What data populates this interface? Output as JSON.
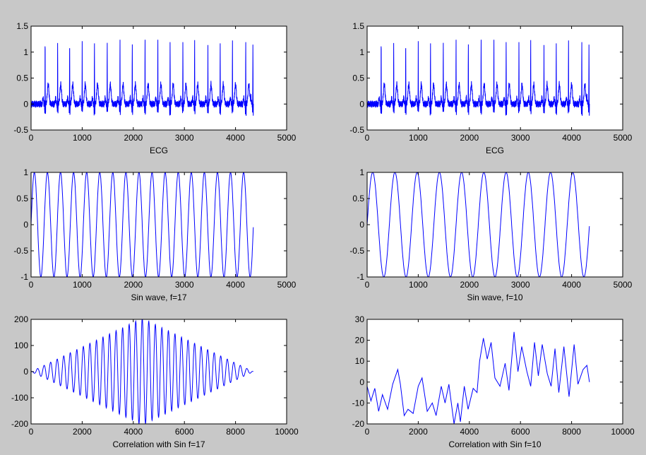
{
  "figure": {
    "background": "#c8c8c8",
    "axes_background": "#ffffff",
    "line_color": "#0000ff"
  },
  "chart_data": [
    {
      "type": "line",
      "xlabel": "ECG",
      "xlim": [
        0,
        5000
      ],
      "ylim": [
        -0.5,
        1.5
      ],
      "xticks": [
        "0",
        "1000",
        "2000",
        "3000",
        "4000",
        "5000"
      ],
      "yticks": [
        "-0.5",
        "0",
        "0.5",
        "1",
        "1.5"
      ],
      "signal": {
        "kind": "ecg",
        "n": 4350,
        "beats": [
          275,
          520,
          755,
          1000,
          1240,
          1490,
          1740,
          1980,
          2230,
          2480,
          2720,
          2970,
          3200,
          3460,
          3700,
          3940,
          4200,
          4340
        ],
        "r_peak": 1.2,
        "baseline": 0.0,
        "min": -0.45
      }
    },
    {
      "type": "line",
      "xlabel": "ECG",
      "xlim": [
        0,
        5000
      ],
      "ylim": [
        -0.5,
        1.5
      ],
      "xticks": [
        "0",
        "1000",
        "2000",
        "3000",
        "4000",
        "5000"
      ],
      "yticks": [
        "-0.5",
        "0",
        "0.5",
        "1",
        "1.5"
      ],
      "signal": {
        "kind": "ecg",
        "n": 4350,
        "beats": [
          275,
          520,
          755,
          1000,
          1240,
          1490,
          1740,
          1980,
          2230,
          2480,
          2720,
          2970,
          3200,
          3460,
          3700,
          3940,
          4200,
          4340
        ],
        "r_peak": 1.2,
        "baseline": 0.0,
        "min": -0.45
      }
    },
    {
      "type": "line",
      "xlabel": "Sin wave, f=17",
      "xlim": [
        0,
        5000
      ],
      "ylim": [
        -1,
        1
      ],
      "xticks": [
        "0",
        "1000",
        "2000",
        "3000",
        "4000",
        "5000"
      ],
      "yticks": [
        "-1",
        "-0.5",
        "0",
        "0.5",
        "1"
      ],
      "signal": {
        "kind": "sin",
        "n": 4350,
        "cycles": 17,
        "amplitude": 1
      }
    },
    {
      "type": "line",
      "xlabel": "Sin wave, f=10",
      "xlim": [
        0,
        5000
      ],
      "ylim": [
        -1,
        1
      ],
      "xticks": [
        "0",
        "1000",
        "2000",
        "3000",
        "4000",
        "5000"
      ],
      "yticks": [
        "-1",
        "-0.5",
        "0",
        "0.5",
        "1"
      ],
      "signal": {
        "kind": "sin",
        "n": 4350,
        "cycles": 10,
        "amplitude": 1
      }
    },
    {
      "type": "line",
      "xlabel": "Correlation with Sin f=17",
      "xlim": [
        0,
        10000
      ],
      "ylim": [
        -200,
        200
      ],
      "xticks": [
        "0",
        "2000",
        "4000",
        "6000",
        "8000",
        "10000"
      ],
      "yticks": [
        "-200",
        "-100",
        "0",
        "100",
        "200"
      ],
      "signal": {
        "kind": "xcorr_diamond",
        "n": 8700,
        "center": 4350,
        "period": 256,
        "peak": 205
      }
    },
    {
      "type": "line",
      "xlabel": "Correlation with Sin f=10",
      "xlim": [
        0,
        10000
      ],
      "ylim": [
        -20,
        30
      ],
      "xticks": [
        "0",
        "2000",
        "4000",
        "6000",
        "8000",
        "10000"
      ],
      "yticks": [
        "-20",
        "-10",
        "0",
        "10",
        "20",
        "30"
      ],
      "points": [
        [
          0,
          -2
        ],
        [
          150,
          -9
        ],
        [
          300,
          -3
        ],
        [
          450,
          -14
        ],
        [
          600,
          -6
        ],
        [
          800,
          -13
        ],
        [
          1000,
          -1
        ],
        [
          1200,
          6
        ],
        [
          1300,
          -1
        ],
        [
          1450,
          -16
        ],
        [
          1600,
          -13
        ],
        [
          1800,
          -15
        ],
        [
          2000,
          -2
        ],
        [
          2150,
          2
        ],
        [
          2350,
          -14
        ],
        [
          2550,
          -10
        ],
        [
          2700,
          -16
        ],
        [
          2900,
          -2
        ],
        [
          3050,
          -10
        ],
        [
          3200,
          -1
        ],
        [
          3400,
          -20
        ],
        [
          3550,
          -10
        ],
        [
          3650,
          -19
        ],
        [
          3800,
          -2
        ],
        [
          3950,
          -13
        ],
        [
          4150,
          -3
        ],
        [
          4300,
          -5
        ],
        [
          4400,
          10
        ],
        [
          4550,
          21
        ],
        [
          4700,
          11
        ],
        [
          4850,
          19
        ],
        [
          5000,
          2
        ],
        [
          5200,
          -2
        ],
        [
          5400,
          9
        ],
        [
          5550,
          -4
        ],
        [
          5750,
          24
        ],
        [
          5900,
          5
        ],
        [
          6050,
          17
        ],
        [
          6250,
          5
        ],
        [
          6400,
          -2
        ],
        [
          6550,
          19
        ],
        [
          6700,
          3
        ],
        [
          6850,
          18
        ],
        [
          7050,
          4
        ],
        [
          7200,
          -2
        ],
        [
          7350,
          16
        ],
        [
          7500,
          -5
        ],
        [
          7700,
          17
        ],
        [
          7900,
          -7
        ],
        [
          8100,
          18
        ],
        [
          8250,
          -1
        ],
        [
          8450,
          6
        ],
        [
          8600,
          8
        ],
        [
          8700,
          0
        ]
      ]
    }
  ]
}
